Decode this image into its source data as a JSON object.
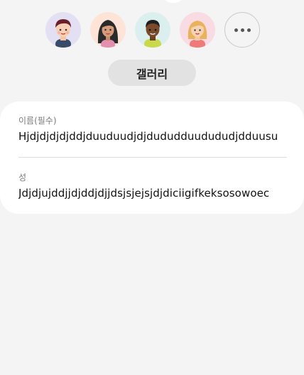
{
  "avatars": [
    {
      "icon": "boy-avatar-icon",
      "bg": "#e3e0f3"
    },
    {
      "icon": "girl-avatar-icon",
      "bg": "#fde4d6"
    },
    {
      "icon": "man-avatar-icon",
      "bg": "#dcefef"
    },
    {
      "icon": "woman-avatar-icon",
      "bg": "#f9dbe4"
    }
  ],
  "more_button": {
    "icon": "more-dots-icon"
  },
  "gallery_button": {
    "label": "갤러리"
  },
  "form": {
    "first_name": {
      "label": "이름(필수)",
      "value": "Hjdjdjdjdjddjduuduudjdjdudud​duudududjdduusu"
    },
    "last_name": {
      "label": "성",
      "value": "Jdjdjujddjjdjddjdjjdsjsjejsjdjdiciigifkeksosowoec"
    }
  },
  "colors": {
    "background": "#f4f4f4",
    "card": "#ffffff",
    "button_bg": "#e2e2e2"
  }
}
